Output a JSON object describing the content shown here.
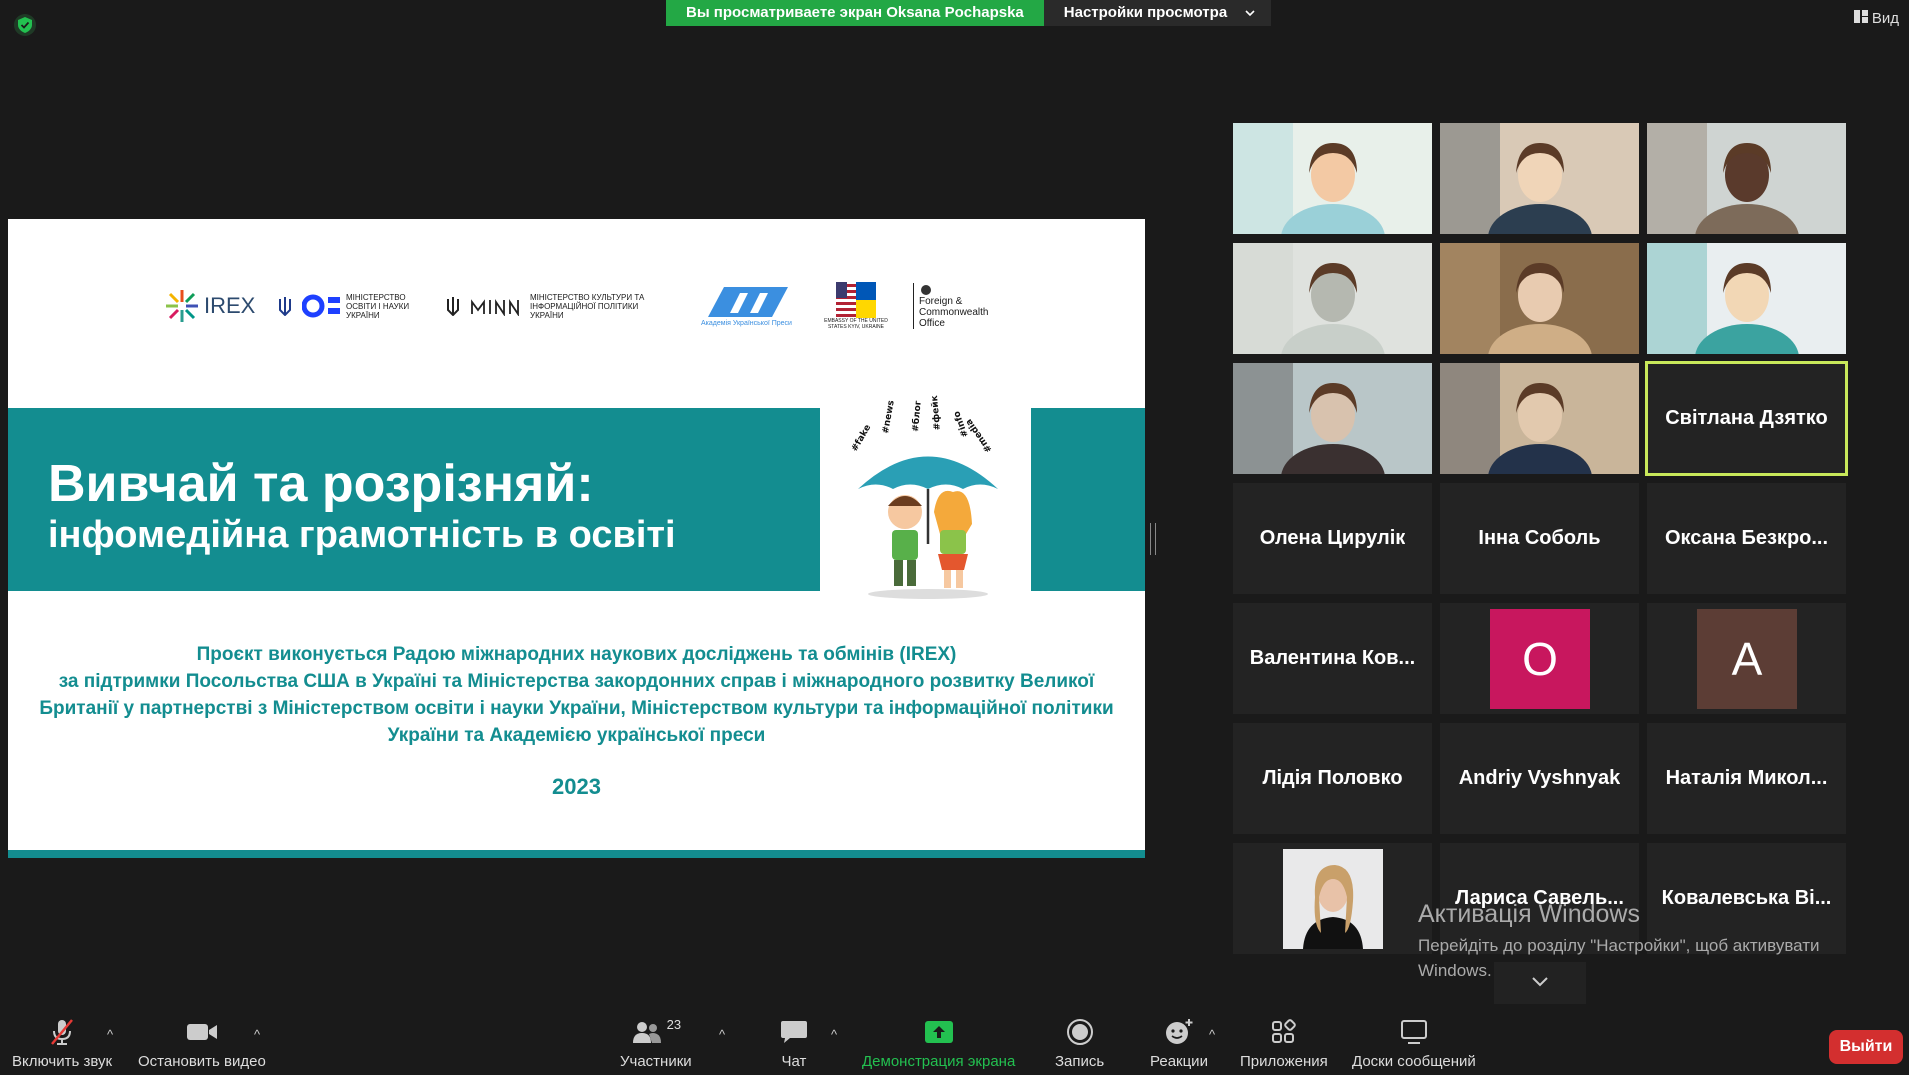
{
  "top_bar": {
    "share_text": "Вы просматриваете экран Oksana Pochapska",
    "view_options_label": "Настройки просмотра",
    "view_label": "Вид"
  },
  "slide": {
    "title": "Вивчай та розрізняй:",
    "subtitle": "інфомедійна грамотність в освіті",
    "description_lines": [
      "Проєкт виконується Радою міжнародних наукових досліджень та обмінів (IREX)",
      "за підтримки Посольства США в Україні та Міністерства закордонних справ і міжнародного розвитку Великої",
      "Британії у партнерстві з Міністерством освіти і науки України, Міністерством культури та інформаційної політики",
      "України та Академією української преси"
    ],
    "year": "2023",
    "logos": {
      "irex": "IREX",
      "mon": "МІНІСТЕРСТВО ОСВІТИ І НАУКИ УКРАЇНИ",
      "mkip": "МІНІСТЕРСТВО КУЛЬТУРИ ТА ІНФОРМАЦІЙНОЇ ПОЛІТИКИ УКРАЇНИ",
      "aup": "Академія Української Преси",
      "embassy": "EMBASSY OF THE UNITED STATES KYIV, UKRAINE",
      "fco": "Foreign & Commonwealth Office"
    },
    "accent_color": "#138d90"
  },
  "participants": [
    {
      "name": "",
      "type": "video"
    },
    {
      "name": "",
      "type": "video"
    },
    {
      "name": "",
      "type": "video"
    },
    {
      "name": "",
      "type": "video"
    },
    {
      "name": "",
      "type": "video"
    },
    {
      "name": "",
      "type": "video"
    },
    {
      "name": "",
      "type": "video"
    },
    {
      "name": "",
      "type": "video"
    },
    {
      "name": "Світлана Дзятко",
      "type": "name",
      "active": true
    },
    {
      "name": "Олена Цирулік",
      "type": "name"
    },
    {
      "name": "Інна Соболь",
      "type": "name"
    },
    {
      "name": "Оксана Безкро...",
      "type": "name"
    },
    {
      "name": "Валентина Ков...",
      "type": "name"
    },
    {
      "name": "",
      "type": "avatar",
      "letter": "О",
      "color": "#c8175e"
    },
    {
      "name": "",
      "type": "avatar",
      "letter": "А",
      "color": "#5c3d35"
    },
    {
      "name": "Лідія Половко",
      "type": "name"
    },
    {
      "name": "Andriy Vyshnyak",
      "type": "name"
    },
    {
      "name": "Наталія Микол...",
      "type": "name"
    },
    {
      "name": "",
      "type": "photo"
    },
    {
      "name": "Лариса Савель...",
      "type": "name"
    },
    {
      "name": "Ковалевська Ві...",
      "type": "name"
    }
  ],
  "activation": {
    "title": "Активація Windows",
    "text": "Перейдіть до розділу \"Настройки\", щоб активувати Windows."
  },
  "toolbar": {
    "unmute": "Включить звук",
    "stop_video": "Остановить видео",
    "participants": "Участники",
    "participants_count": "23",
    "chat": "Чат",
    "share_screen": "Демонстрация экрана",
    "record": "Запись",
    "reactions": "Реакции",
    "apps": "Приложения",
    "whiteboards": "Доски сообщений",
    "leave": "Выйти"
  }
}
